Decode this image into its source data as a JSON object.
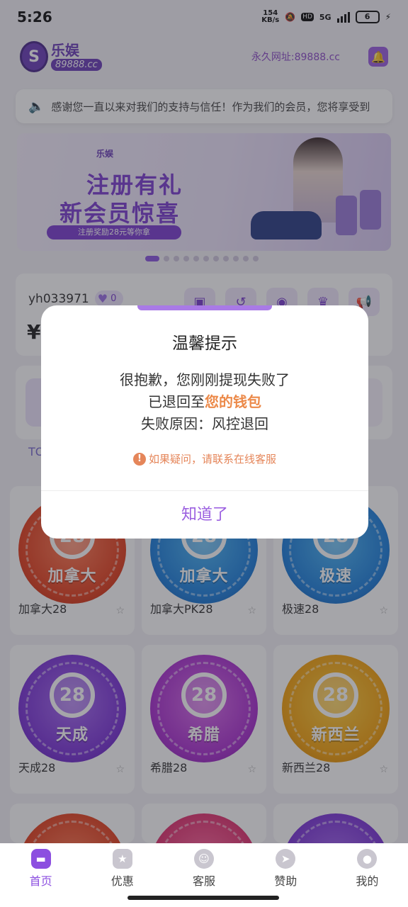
{
  "status_bar": {
    "time": "5:26",
    "speed_value": "154",
    "speed_unit": "KB/s",
    "network": "5G",
    "battery": "6"
  },
  "header": {
    "logo_cn": "乐娱",
    "logo_url": "89888.cc",
    "permanent_url": "永久网址:89888.cc"
  },
  "notice": {
    "text": "感谢您一直以来对我们的支持与信任！作为我们的会员，您将享受到"
  },
  "banner": {
    "logo": "乐娱",
    "title_1": "注册有礼",
    "title_2": "新会员惊喜",
    "bar": "注册奖励28元等你拿"
  },
  "account": {
    "username": "yh033971",
    "vip_level": "0",
    "balance_symbol": "¥"
  },
  "tabs_label": "TO",
  "games": [
    {
      "name": "加拿大28",
      "chip_number": "28",
      "chip_label": "加拿大",
      "color": "orange"
    },
    {
      "name": "加拿大PK28",
      "chip_number": "28",
      "chip_label": "加拿大",
      "color": "blue"
    },
    {
      "name": "极速28",
      "chip_number": "28",
      "chip_label": "极速",
      "color": "blue"
    },
    {
      "name": "天成28",
      "chip_number": "28",
      "chip_label": "天成",
      "color": "purple"
    },
    {
      "name": "希腊28",
      "chip_number": "28",
      "chip_label": "希腊",
      "color": "magenta"
    },
    {
      "name": "新西兰28",
      "chip_number": "28",
      "chip_label": "新西兰",
      "color": "gold"
    }
  ],
  "dialog": {
    "title": "温馨提示",
    "line_1": "很抱歉，您刚刚提现失败了",
    "line_2_prefix": "已退回至",
    "line_2_highlight": "您的钱包",
    "line_3": "失败原因：风控退回",
    "notice": "如果疑问，请联系在线客服",
    "ok_button": "知道了"
  },
  "bottom_nav": [
    {
      "label": "首页",
      "active": true
    },
    {
      "label": "优惠",
      "active": false
    },
    {
      "label": "客服",
      "active": false
    },
    {
      "label": "赞助",
      "active": false
    },
    {
      "label": "我的",
      "active": false
    }
  ],
  "colors": {
    "accent": "#8c4fe0",
    "highlight": "#ec8a4a",
    "overlay": "rgba(40,40,50,0.42)"
  }
}
